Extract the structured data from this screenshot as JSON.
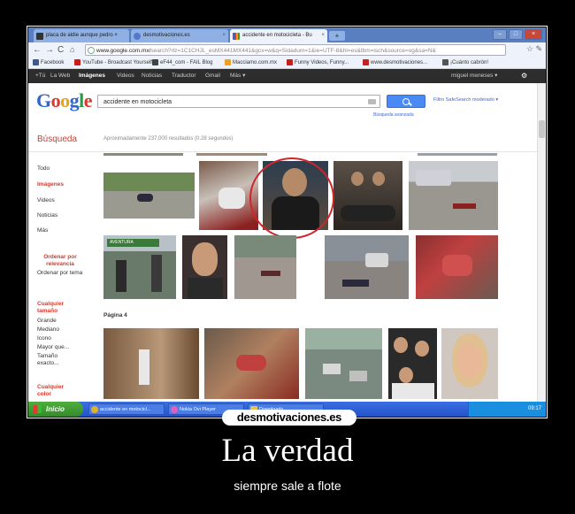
{
  "browser": {
    "tabs": [
      {
        "label": "placa de aldie aunque pedro ×",
        "active": false
      },
      {
        "label": "desmotivaciones.es",
        "active": false
      },
      {
        "label": "accidente en motocicleta - Bu",
        "active": true
      }
    ],
    "url_host": "www.google.com.mx/",
    "url_path": "search?rlz=1C1CHJL_esMX441MX441&gcx=w&q=Sidadum=1&ie=UTF-8&hl=es&tbm=isch&source=og&sa=N&",
    "bookmarks": [
      {
        "label": "Facebook",
        "color": "#3b5998"
      },
      {
        "label": "YouTube - Broadcast Yourself",
        "color": "#cc1b1b"
      },
      {
        "label": "eF44_com - FAIL Blog",
        "color": "#444444"
      },
      {
        "label": "Macciamo.com.mx",
        "color": "#f0a020"
      },
      {
        "label": "Funny Videos, Funny...",
        "color": "#c82020"
      },
      {
        "label": "www.desmotivaciones...",
        "color": "#c82020"
      },
      {
        "label": "¡Cuánto cabrón!",
        "color": "#555555"
      }
    ]
  },
  "google": {
    "bar_items": [
      "+Tú",
      "La Web",
      "Imágenes",
      "Videos",
      "Noticias",
      "Traductor",
      "Gmail",
      "Más ▾"
    ],
    "active_item": "Imágenes",
    "user": "miguel meneses ▾",
    "logo": "Google",
    "query": "accidente en motocicleta",
    "advanced_search": "Búsqueda avanzada",
    "safesearch": "Filtro SafeSearch moderado ▾",
    "section_title": "Búsqueda",
    "results_count": "Aproximadamente 237,000 resultados (0.28 segundos)",
    "page_label": "Página 4"
  },
  "leftnav": {
    "items": [
      "Todo",
      "Imágenes",
      "Videos",
      "Noticias",
      "Más"
    ],
    "sort_title": "Ordenar por relevancia",
    "sort_option": "Ordenar por tema",
    "size_title": "Cualquier tamaño",
    "size_options": [
      "Grande",
      "Mediano",
      "Icono",
      "Mayor que...",
      "Tamaño exacto..."
    ],
    "color_title": "Cualquier color"
  },
  "taskbar": {
    "start": "Inicio",
    "tasks": [
      {
        "label": "accidente en motocicl...",
        "color": "#e0b030"
      },
      {
        "label": "Nokia Ovi Player",
        "color": "#e060c0"
      },
      {
        "label": "Downloads",
        "color": "#e8c050"
      }
    ],
    "clock": "09:17"
  },
  "poster": {
    "watermark": "desmotivaciones.es",
    "title": "La verdad",
    "subtitle": "siempre sale a flote"
  },
  "colors": {
    "poster_bg": "#000000",
    "google_red": "#d73a2c",
    "google_blue": "#3366cc",
    "highlight_circle": "#d0262a"
  }
}
